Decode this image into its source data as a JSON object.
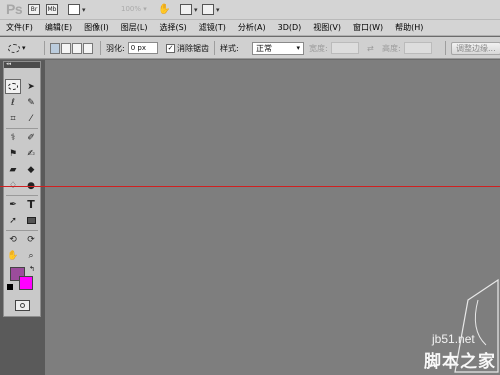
{
  "app": {
    "logo": "Ps",
    "zoom": "100%"
  },
  "menu": [
    "文件(F)",
    "编辑(E)",
    "图像(I)",
    "图层(L)",
    "选择(S)",
    "滤镜(T)",
    "分析(A)",
    "3D(D)",
    "视图(V)",
    "窗口(W)",
    "帮助(H)"
  ],
  "options": {
    "feather_label": "羽化:",
    "feather_value": "0 px",
    "antialias_label": "消除锯齿",
    "antialias_checked": true,
    "style_label": "样式:",
    "style_value": "正常",
    "width_label": "宽度:",
    "height_label": "高度:",
    "refine_button": "调整边缘..."
  },
  "toolbox": {
    "header": "◂◂",
    "foreground_color": "#9c4c9c",
    "background_color": "#ff00ff"
  },
  "canvas": {
    "guide_color": "#d02020"
  },
  "watermark": {
    "site": "jb51.net",
    "name": "脚本之家"
  }
}
